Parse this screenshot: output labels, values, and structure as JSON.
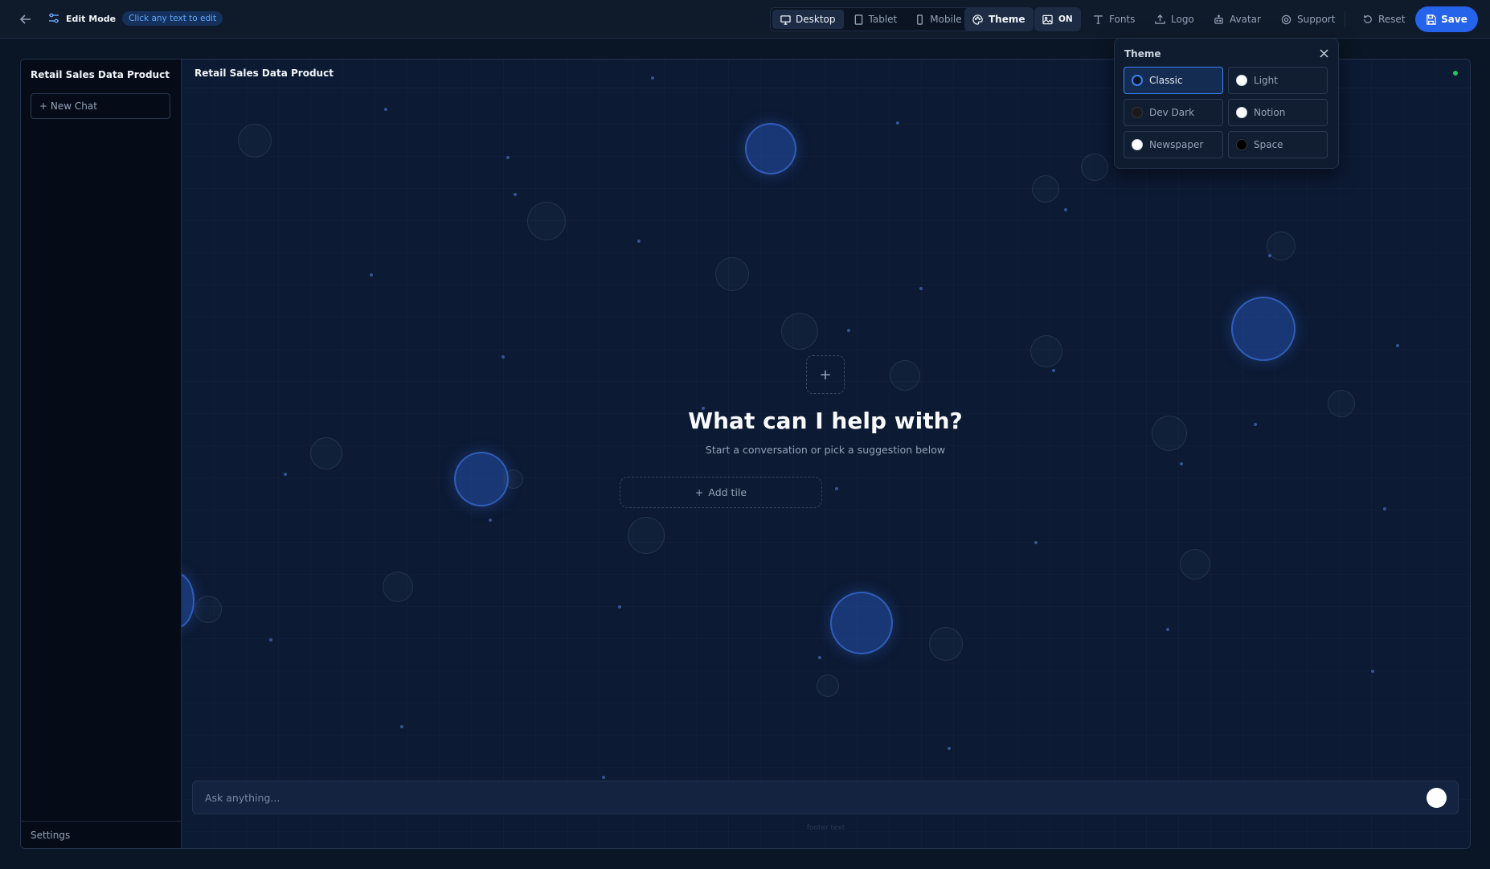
{
  "toolbar": {
    "edit_mode_label": "Edit Mode",
    "edit_hint": "Click any text to edit",
    "devices": [
      {
        "label": "Desktop",
        "icon": "monitor-icon",
        "active": true
      },
      {
        "label": "Tablet",
        "icon": "tablet-icon",
        "active": false
      },
      {
        "label": "Mobile",
        "icon": "mobile-icon",
        "active": false
      }
    ],
    "theme_label": "Theme",
    "image_toggle_label": "ON",
    "fonts_label": "Fonts",
    "logo_label": "Logo",
    "avatar_label": "Avatar",
    "support_label": "Support",
    "reset_label": "Reset",
    "save_label": "Save"
  },
  "sidebar": {
    "title": "Retail Sales Data Product",
    "new_chat_label": "+ New Chat",
    "settings_label": "Settings"
  },
  "main": {
    "title": "Retail Sales Data Product",
    "hero_title": "What can I help with?",
    "hero_subtitle": "Start a conversation or pick a suggestion below",
    "add_tile_label": "Add tile",
    "chat_placeholder": "Ask anything...",
    "footer_text": "footer text"
  },
  "theme_panel": {
    "title": "Theme",
    "options": [
      {
        "label": "Classic",
        "swatch": "#0a1525",
        "active": true
      },
      {
        "label": "Light",
        "swatch": "#ffffff",
        "active": false
      },
      {
        "label": "Dev Dark",
        "swatch": "#1a1a1a",
        "active": false
      },
      {
        "label": "Notion",
        "swatch": "#ffffff",
        "active": false
      },
      {
        "label": "Newspaper",
        "swatch": "#ffffff",
        "active": false
      },
      {
        "label": "Space",
        "swatch": "#000000",
        "active": false
      }
    ]
  },
  "colors": {
    "accent": "#2563eb",
    "status_online": "#22c55e",
    "background": "#0a1525"
  }
}
